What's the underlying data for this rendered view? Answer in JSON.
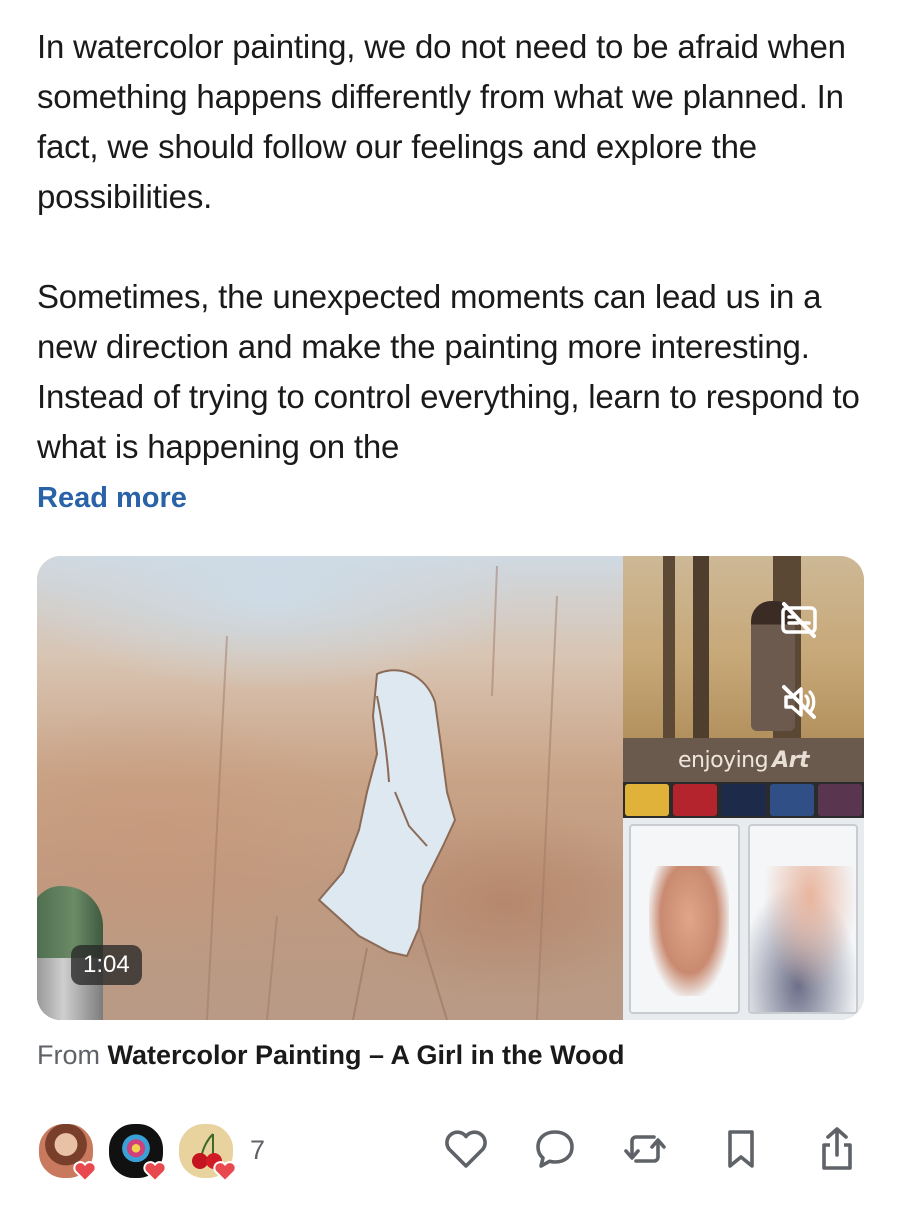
{
  "post": {
    "paragraphs": [
      "In watercolor painting, we do not need to be afraid when something happens differently from what we planned. In fact, we should follow our feelings and explore the possibilities.",
      "Sometimes, the unexpected moments can lead us in a new direction and make the painting more interesting. Instead of trying to control everything, learn to respond to what is happening on the"
    ],
    "read_more": "Read more"
  },
  "video": {
    "duration": "1:04",
    "brand_text": "enjoying",
    "brand_script": "Art",
    "icons": [
      "captions-off-icon",
      "mute-icon"
    ]
  },
  "source": {
    "prefix": "From",
    "title": "Watercolor Painting – A Girl in the Wood"
  },
  "reactions": {
    "count": "7",
    "avatars": [
      "user-avatar-woman",
      "user-avatar-logo",
      "user-avatar-cherries"
    ]
  },
  "actions": [
    "like-icon",
    "comment-icon",
    "repost-icon",
    "bookmark-icon",
    "share-icon"
  ],
  "colors": {
    "link": "#2a62a8",
    "text": "#1a1a1a",
    "muted": "#5f6368",
    "heart_badge": "#e8494f"
  }
}
